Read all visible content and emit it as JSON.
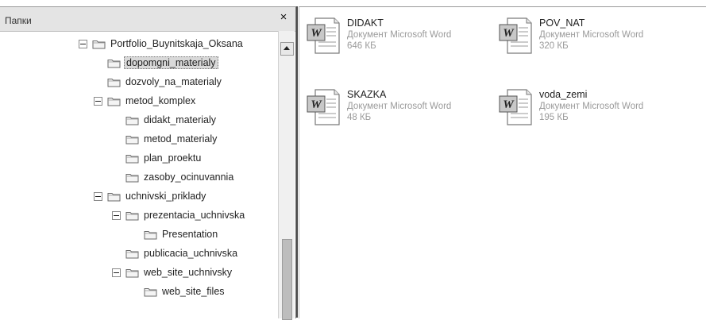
{
  "folders_pane": {
    "title": "Папки",
    "close_glyph": "×",
    "tree": [
      {
        "label": "Portfolio_Buynitskaja_Oksana",
        "expanded": true,
        "selected": false,
        "icon": "folder-icon"
      },
      {
        "label": "dopomgni_materialy",
        "expanded": false,
        "selected": true,
        "icon": "folder-icon"
      },
      {
        "label": "dozvoly_na_materialy",
        "expanded": false,
        "selected": false,
        "icon": "folder-icon"
      },
      {
        "label": "metod_komplex",
        "expanded": true,
        "selected": false,
        "icon": "folder-icon"
      },
      {
        "label": "didakt_materialy",
        "expanded": false,
        "selected": false,
        "icon": "folder-icon"
      },
      {
        "label": "metod_materialy",
        "expanded": false,
        "selected": false,
        "icon": "folder-icon"
      },
      {
        "label": "plan_proektu",
        "expanded": false,
        "selected": false,
        "icon": "folder-icon"
      },
      {
        "label": "zasoby_ocinuvannia",
        "expanded": false,
        "selected": false,
        "icon": "folder-icon"
      },
      {
        "label": "uchnivski_priklady",
        "expanded": true,
        "selected": false,
        "icon": "folder-icon"
      },
      {
        "label": "prezentacia_uchnivska",
        "expanded": true,
        "selected": false,
        "icon": "folder-icon"
      },
      {
        "label": "Presentation",
        "expanded": false,
        "selected": false,
        "icon": "folder-icon"
      },
      {
        "label": "publicacia_uchnivska",
        "expanded": false,
        "selected": false,
        "icon": "folder-icon"
      },
      {
        "label": "web_site_uchnivsky",
        "expanded": true,
        "selected": false,
        "icon": "folder-icon"
      },
      {
        "label": "web_site_files",
        "expanded": false,
        "selected": false,
        "icon": "folder-icon"
      }
    ]
  },
  "files_pane": {
    "files": [
      {
        "name": "DIDAKT",
        "type": "Документ Microsoft Word",
        "size": "646 КБ",
        "icon": "word-document-icon"
      },
      {
        "name": "POV_NAT",
        "type": "Документ Microsoft Word",
        "size": "320 КБ",
        "icon": "word-document-icon"
      },
      {
        "name": "SKAZKA",
        "type": "Документ Microsoft Word",
        "size": "48 КБ",
        "icon": "word-document-icon"
      },
      {
        "name": "voda_zemi",
        "type": "Документ Microsoft Word",
        "size": "195 КБ",
        "icon": "word-document-icon"
      }
    ]
  },
  "colors": {
    "folder_fill": "#f4f4f4",
    "folder_stroke": "#6a6a6a",
    "selected_bg": "#d9d9d9",
    "meta_text": "#9a9a9a"
  }
}
